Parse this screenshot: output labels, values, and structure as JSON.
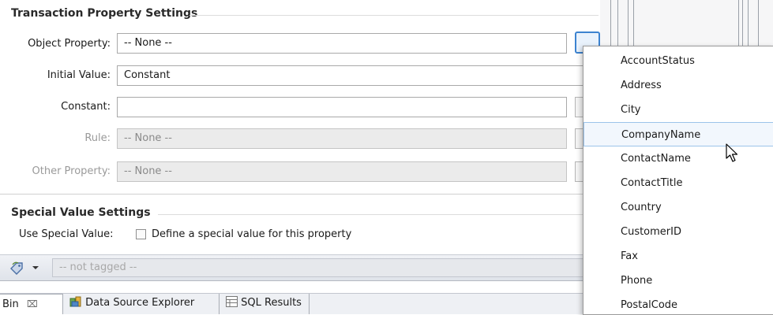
{
  "transaction_section": {
    "title": "Transaction Property Settings"
  },
  "form": {
    "object_property": {
      "label": "Object Property:",
      "value": "-- None --"
    },
    "initial_value": {
      "label": "Initial Value:",
      "value": "Constant"
    },
    "constant": {
      "label": "Constant:",
      "value": ""
    },
    "rule": {
      "label": "Rule:",
      "value": "-- None --"
    },
    "other_property": {
      "label": "Other Property:",
      "value": "-- None --"
    }
  },
  "special_section": {
    "title": "Special Value Settings",
    "use_label": "Use Special Value:",
    "checkbox_label": "Define a special value for this property",
    "checked": false
  },
  "tagbar": {
    "placeholder": "-- not tagged --"
  },
  "bottom_tabs": [
    {
      "label": "Bin",
      "close": "⌧",
      "active": true
    },
    {
      "label": "Data Source Explorer",
      "active": false
    },
    {
      "label": "SQL Results",
      "active": false
    }
  ],
  "dropdown": {
    "selected": "CompanyName",
    "items": [
      "AccountStatus",
      "Address",
      "City",
      "CompanyName",
      "ContactName",
      "ContactTitle",
      "Country",
      "CustomerID",
      "Fax",
      "Phone",
      "PostalCode"
    ]
  },
  "icons": {
    "tag": "tag-icon",
    "chevron": "chevron-down-icon",
    "data_source": "database-icon",
    "sql": "table-icon",
    "cursor": "mouse-pointer-icon"
  },
  "colors": {
    "accent": "#3c83d0",
    "selection": "#f2f7fd"
  }
}
